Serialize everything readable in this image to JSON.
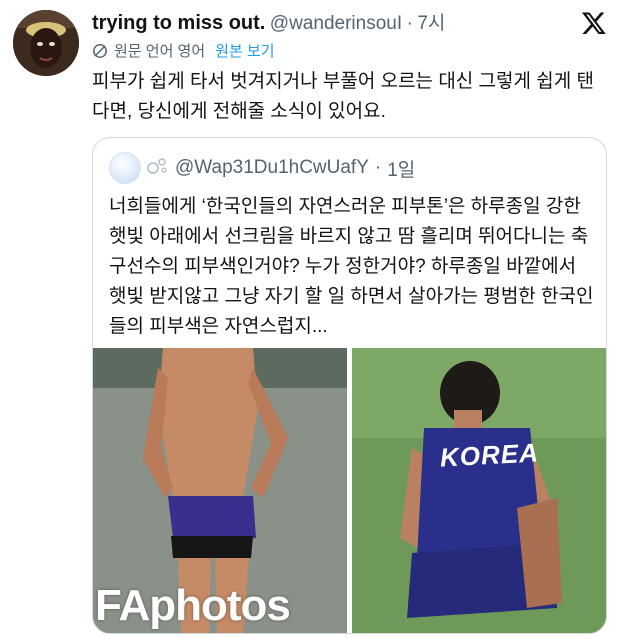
{
  "tweet": {
    "display_name": "trying to miss out.",
    "handle": "@wanderinsouI",
    "separator": "·",
    "time": "7시",
    "translate_label": "원문 언어 영어",
    "translate_link": "원본 보기",
    "text": "피부가 쉽게 타서 벗겨지거나 부풀어 오르는 대신 그렇게 쉽게 탠다면, 당신에게 전해줄 소식이 있어요."
  },
  "quote": {
    "handle": "@Wap31Du1hCwUafY",
    "separator": "·",
    "time": "1일",
    "text": "너희들에게 ‘한국인들의 자연스러운 피부톤’은 하루종일 강한 햇빛 아래에서 선크림을 바르지 않고 땀 흘리며 뛰어다니는 축구선수의 피부색인거야? 누가 정한거야? 하루종일 바깥에서 햇빛 받지않고 그냥 자기 할 일 하면서 살아가는 평범한 한국인들의 피부색은 자연스럽지...",
    "images": [
      {
        "watermark": "FAphotos"
      },
      {
        "jersey_text": "KOREA"
      }
    ]
  },
  "icons": {
    "x_logo": "x-logo-icon",
    "translate": "globe-translate-icon",
    "quote_badge": "loop-badge-icon"
  },
  "colors": {
    "link": "#1d9bf0",
    "secondary_text": "#536471",
    "jersey": "#2b2f8c",
    "grass": "#6f9958"
  }
}
